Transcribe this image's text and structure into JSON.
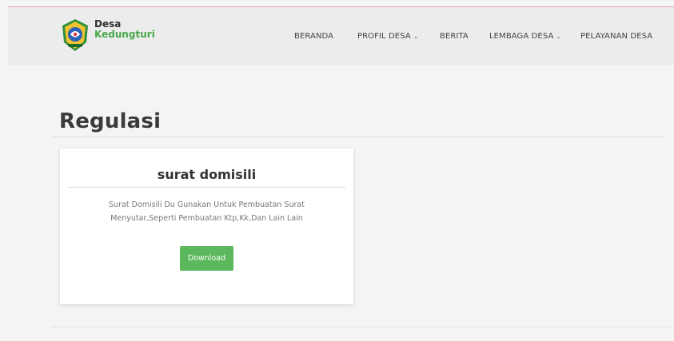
{
  "header": {
    "brand": {
      "line1": "Desa",
      "line2": "Kedungturi"
    },
    "nav": [
      {
        "label": "BERANDA",
        "dropdown": false
      },
      {
        "label": "PROFIL DESA",
        "dropdown": true
      },
      {
        "label": "BERITA",
        "dropdown": false
      },
      {
        "label": "LEMBAGA DESA",
        "dropdown": true
      },
      {
        "label": "PELAYANAN DESA",
        "dropdown": false
      }
    ]
  },
  "main": {
    "page_title": "Regulasi",
    "cards": [
      {
        "title": "surat domisili",
        "description": "Surat Domisili Du Gunakan Untuk Pembuatan Surat Menyutar,Seperti Pembuatan Ktp,Kk,Dan Lain Lain",
        "button_label": "Download"
      }
    ]
  },
  "colors": {
    "accent_green": "#5cb85c",
    "brand_green": "#4aa84a",
    "navbar_bg": "#ececec",
    "page_bg": "#f4f4f4"
  },
  "icons": {
    "logo": "village-emblem-icon",
    "dropdown": "chevron-down-icon"
  }
}
